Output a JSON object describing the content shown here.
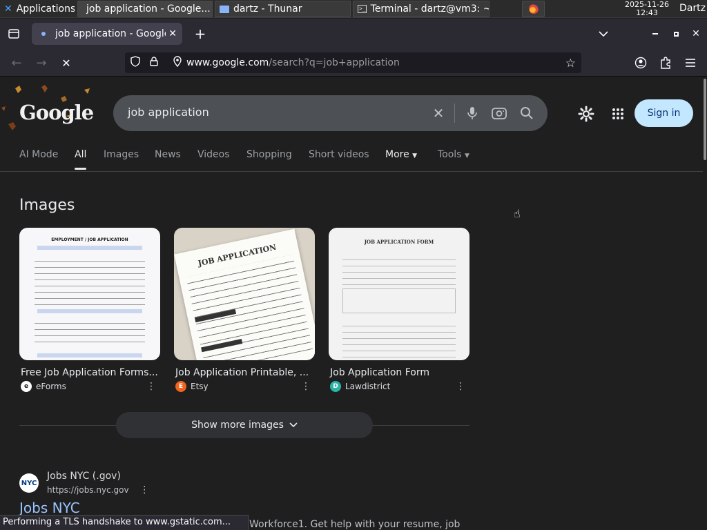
{
  "taskbar": {
    "apps_label": "Applications",
    "windows": [
      {
        "title": "job application - Google..."
      },
      {
        "title": "dartz - Thunar"
      },
      {
        "title": "Terminal - dartz@vm3: ~"
      }
    ],
    "date": "2025-11-26",
    "time": "12:43",
    "user": "Dartz"
  },
  "browser": {
    "tab_title": "job application - Google S",
    "url_host": "www.google.com",
    "url_path": "/search?q=job+application",
    "status": "Performing a TLS handshake to www.gstatic.com..."
  },
  "google": {
    "logo_text": "Google",
    "query": "job application",
    "sign_in": "Sign in",
    "tabs": [
      "AI Mode",
      "All",
      "Images",
      "News",
      "Videos",
      "Shopping",
      "Short videos",
      "More",
      "Tools"
    ],
    "active_tab": "All"
  },
  "images_section": {
    "heading": "Images",
    "cards": [
      {
        "title": "Free Job Application Forms...",
        "source": "eForms",
        "thumb_heading": "EMPLOYMENT / JOB APPLICATION",
        "source_icon_letter": "e"
      },
      {
        "title": "Job Application Printable, ...",
        "source": "Etsy",
        "thumb_heading": "JOB APPLICATION",
        "source_icon_letter": "E"
      },
      {
        "title": "Job Application Form",
        "source": "Lawdistrict",
        "thumb_heading": "JOB APPLICATION FORM",
        "source_icon_letter": "D"
      }
    ],
    "show_more": "Show more images"
  },
  "result": {
    "site_name": "Jobs NYC (.gov)",
    "url": "https://jobs.nyc.gov",
    "title": "Jobs NYC",
    "favicon_text": "NYC",
    "snippet": "Workforce1. Get help with your resume, job"
  },
  "colors": {
    "accent_link": "#99c3ff",
    "signin_bg": "#c2e7ff"
  }
}
